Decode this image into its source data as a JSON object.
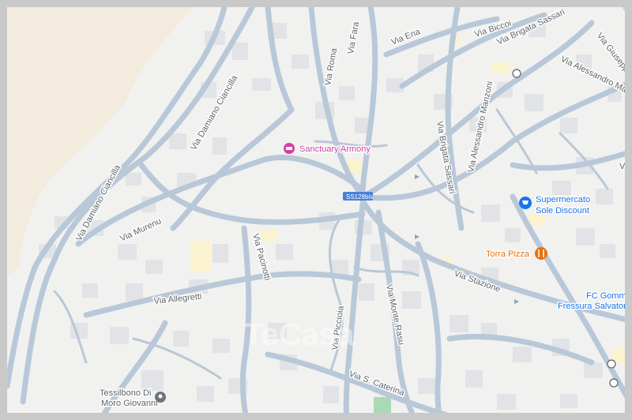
{
  "map": {
    "colors": {
      "background": "#f0f0ee",
      "sand": "#f2ebdd",
      "road": "#b9c8d8",
      "road_casing": "#ffffff",
      "building": "#e2e3e6",
      "building_yellow": "#fbf2cf",
      "park": "#a8dab5",
      "poi_pink": "#d33fa5",
      "poi_blue": "#1a73e8",
      "poi_orange": "#e8710a",
      "poi_gray": "#70757a",
      "route_badge": "#4a7fd6",
      "watermark": "#ffffff"
    },
    "street_labels": [
      "Via Damiano Ciancilla",
      "Via Damiano Ciancilla",
      "Via Murenu",
      "Via Roma",
      "Via Fara",
      "Via Ena",
      "Via Biccoi",
      "Via Brigata Sassari",
      "Via Alessandro Manzoni",
      "Via Giuseppe Mazzini",
      "Via Brigata Sassari",
      "Via Alessandro Manzoni",
      "Via Pacinotti",
      "Via Allegretti",
      "Via Stazione",
      "Via Piccioia",
      "Via Monte Rasu",
      "Via S. Caterina",
      "Via L"
    ],
    "route_badge": "SS128bis",
    "pois": [
      {
        "name": "Sanctuary Armony",
        "icon": "hotel-icon"
      },
      {
        "name_line1": "Supermercato",
        "name_line2": "Sole Discount",
        "icon": "shopping-cart-icon"
      },
      {
        "name": "Torra Pizza",
        "icon": "restaurant-icon"
      },
      {
        "name_line1": "FC Gomme di",
        "name_line2": "Fressura Salvatore...",
        "icon": ""
      },
      {
        "name_line1": "Tessilbono Di",
        "name_line2": "Moro Giovanni",
        "icon": "place-pin-icon"
      }
    ],
    "watermark": "TeCasa"
  }
}
